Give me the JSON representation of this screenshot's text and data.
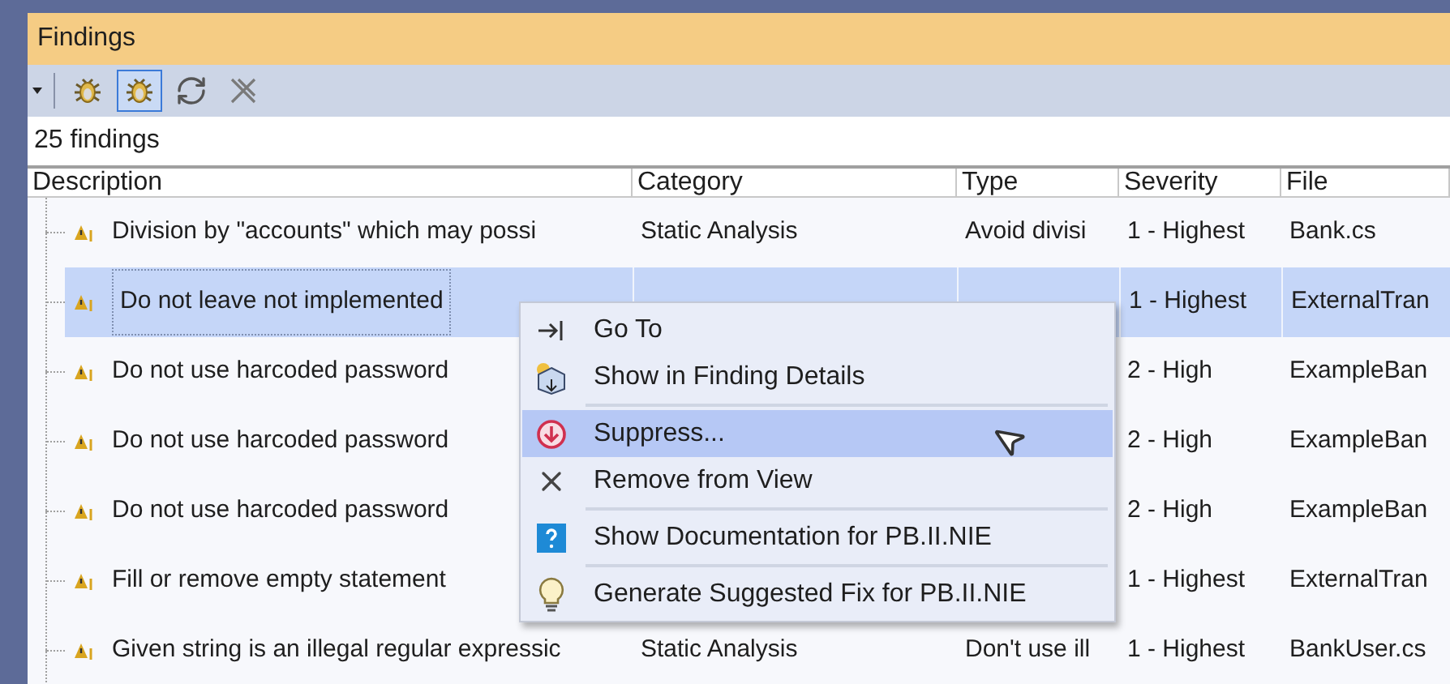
{
  "window": {
    "title": "Findings"
  },
  "toolbar": {
    "buttons": [
      {
        "selected": false
      },
      {
        "selected": true
      },
      {
        "selected": false
      },
      {
        "selected": false
      }
    ]
  },
  "summary": "25 findings",
  "table": {
    "columns": [
      "Description",
      "Category",
      "Type",
      "Severity",
      "File"
    ],
    "rows": [
      {
        "description": "Division by \"accounts\" which may possi",
        "category": "Static Analysis",
        "type": "Avoid divisi",
        "severity": "1 - Highest",
        "file": "Bank.cs",
        "selected": false
      },
      {
        "description": "Do not leave not implemented",
        "severity": "1 - Highest",
        "file": "ExternalTran",
        "selected": true
      },
      {
        "description": "Do not use harcoded password",
        "severity": "2 - High",
        "file": "ExampleBan",
        "selected": false
      },
      {
        "description": "Do not use harcoded password",
        "severity": "2 - High",
        "file": "ExampleBan",
        "selected": false
      },
      {
        "description": "Do not use harcoded password",
        "severity": "2 - High",
        "file": "ExampleBan",
        "selected": false
      },
      {
        "description": "Fill or remove empty statement",
        "severity": "1 - Highest",
        "file": "ExternalTran",
        "selected": false
      },
      {
        "description": "Given string is an illegal regular expressic",
        "category": "Static Analysis",
        "type": "Don't use ill",
        "severity": "1 - Highest",
        "file": "BankUser.cs",
        "selected": false
      }
    ]
  },
  "context_menu": {
    "groups": [
      [
        {
          "label": "Go To",
          "selected": false
        },
        {
          "label": "Show in Finding Details",
          "selected": false
        }
      ],
      [
        {
          "label": "Suppress...",
          "selected": true
        },
        {
          "label": "Remove from View",
          "selected": false
        }
      ],
      [
        {
          "label": "Show Documentation for PB.II.NIE",
          "selected": false
        }
      ],
      [
        {
          "label": "Generate Suggested Fix for PB.II.NIE",
          "selected": false
        }
      ]
    ]
  }
}
